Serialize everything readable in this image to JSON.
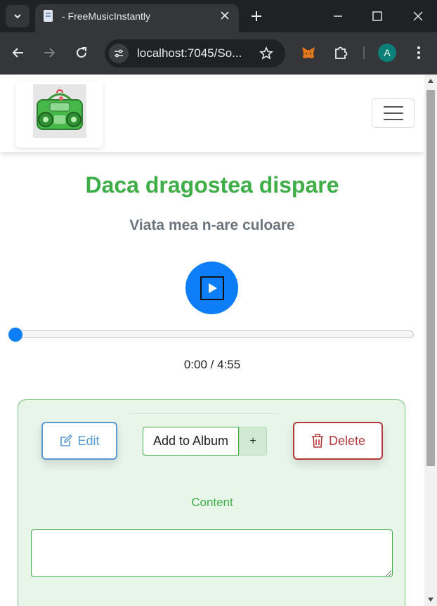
{
  "browser": {
    "tab_title": "- FreeMusicInstantly",
    "url": "localhost:7045/So...",
    "avatar_letter": "A"
  },
  "icons": {
    "tab_list": "chevron-down-icon",
    "favicon": "document-icon",
    "tab_close": "close-icon",
    "new_tab": "plus-icon",
    "minimize": "minimize-icon",
    "maximize": "maximize-icon",
    "window_close": "close-icon",
    "back": "arrow-left-icon",
    "forward": "arrow-right-icon",
    "reload": "reload-icon",
    "site_info": "tune-icon",
    "bookmark": "star-icon",
    "extension_fox": "fox-icon",
    "extensions": "puzzle-icon",
    "menu": "kebab-menu-icon",
    "play": "play-icon",
    "edit": "pencil-square-icon",
    "delete": "trash-icon"
  },
  "page": {
    "song_title": "Daca dragostea dispare",
    "song_subtitle": "Viata mea n-are culoare",
    "player": {
      "time": "0:00 / 4:55",
      "progress": 0
    },
    "actions": {
      "edit_label": "Edit",
      "add_to_album_label": "Add to Album",
      "plus_label": "+",
      "delete_label": "Delete",
      "content_label": "Content",
      "content_value": ""
    }
  },
  "colors": {
    "title_green": "#3fae49",
    "primary_blue": "#0d7ef8",
    "edit_blue": "#5a9ad2",
    "delete_red": "#b5383b",
    "panel_bg": "#e8f5e9"
  }
}
